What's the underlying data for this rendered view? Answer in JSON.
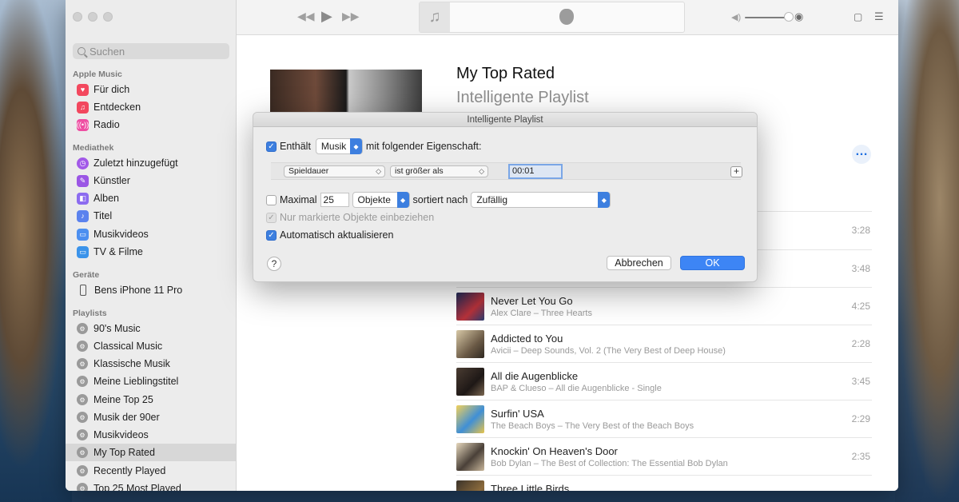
{
  "sidebar": {
    "search_placeholder": "Suchen",
    "sections": {
      "apple_music": "Apple Music",
      "library": "Mediathek",
      "devices": "Geräte",
      "playlists": "Playlists"
    },
    "apple_music_items": [
      "Für dich",
      "Entdecken",
      "Radio"
    ],
    "library_items": [
      "Zuletzt hinzugefügt",
      "Künstler",
      "Alben",
      "Titel",
      "Musikvideos",
      "TV & Filme"
    ],
    "device": "Bens iPhone 11 Pro",
    "playlists": [
      "90's Music",
      "Classical Music",
      "Klassische Musik",
      "Meine Lieblingstitel",
      "Meine Top 25",
      "Musik der 90er",
      "Musikvideos",
      "My Top Rated",
      "Recently Played",
      "Top 25 Most Played"
    ],
    "active_playlist": "My Top Rated"
  },
  "main": {
    "title": "My Top Rated",
    "subtitle": "Intelligente Playlist",
    "hidden_times": [
      "3:28",
      "3:48"
    ],
    "tracks": [
      {
        "title": "Never Let You Go",
        "subtitle": "Alex Clare – Three Hearts",
        "time": "4:25",
        "color": "#2a3b6e"
      },
      {
        "title": "Addicted to You",
        "subtitle": "Avicii – Deep Sounds, Vol. 2 (The Very Best of Deep House)",
        "time": "2:28",
        "color": "#6b5a46"
      },
      {
        "title": "All die Augenblicke",
        "subtitle": "BAP & Clueso – All die Augenblicke - Single",
        "time": "3:45",
        "color": "#3b2f2a"
      },
      {
        "title": "Surfin' USA",
        "subtitle": "The Beach Boys – The Very Best of the Beach Boys",
        "time": "2:29",
        "color": "#e8c44a"
      },
      {
        "title": "Knockin' On Heaven's Door",
        "subtitle": "Bob Dylan – The Best of Collection: The Essential Bob Dylan",
        "time": "2:35",
        "color": "#c9b79b"
      },
      {
        "title": "Three Little Birds",
        "subtitle": "",
        "time": "",
        "color": "#2e2a24"
      }
    ]
  },
  "dialog": {
    "title": "Intelligente Playlist",
    "contains_label": "Enthält",
    "media_type": "Musik",
    "property_label": "mit folgender Eigenschaft:",
    "criterion_field": "Spieldauer",
    "criterion_operator": "ist größer als",
    "criterion_value": "00:01",
    "limit_label": "Maximal",
    "limit_value": "25",
    "limit_unit": "Objekte",
    "sorted_by_label": "sortiert nach",
    "sorted_by_value": "Zufällig",
    "only_checked_label": "Nur markierte Objekte einbeziehen",
    "live_update_label": "Automatisch aktualisieren",
    "help": "?",
    "cancel": "Abbrechen",
    "ok": "OK"
  }
}
